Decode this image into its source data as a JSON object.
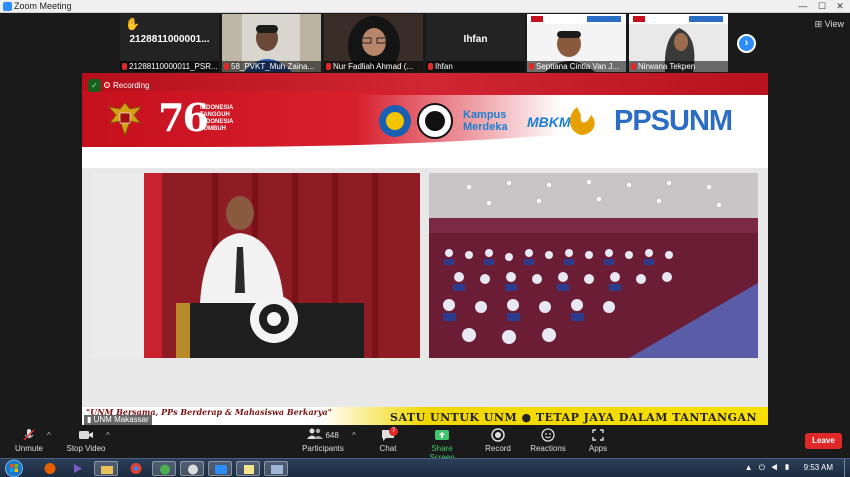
{
  "window": {
    "title": "Zoom Meeting",
    "minimize": "—",
    "maximize": "☐",
    "close": "✕"
  },
  "view_button": {
    "label": "View"
  },
  "gallery": {
    "tiles": [
      {
        "display": "2128811000001...",
        "name": "21288110000011_PSR...",
        "hand_raised": true
      },
      {
        "display": "",
        "name": "58_PVKT_Muh Zaina...",
        "hand_raised": false
      },
      {
        "display": "",
        "name": "Nur Fadliah Ahmad (...",
        "hand_raised": false
      },
      {
        "display": "Ihfan",
        "name": "Ihfan",
        "hand_raised": false
      },
      {
        "display": "",
        "name": "Septiana Cintia Van J...",
        "hand_raised": false
      },
      {
        "display": "",
        "name": "Nirwana Tekpen",
        "hand_raised": false
      }
    ]
  },
  "stage": {
    "recording_label": "Recording",
    "anniversary_number": "76",
    "slogan": [
      "INDONESIA",
      "TANGGUH",
      "INDONESIA",
      "TUMBUH"
    ],
    "logo_kampus": "Kampus",
    "logo_merdeka": "Merdeka",
    "logo_mbkm": "MBKM",
    "logo_pps": "PPS",
    "logo_unm": "UNM",
    "footer_tagline": "\"UNM Bersama, PPs Berderap & Mahasiswa Berkarya\"",
    "footer_ticker": "SATU UNTUK UNM  ●  TETAP JAYA DALAM TANTANGAN",
    "speaker_name_tag": "UNM Makassar"
  },
  "toolbar": {
    "unmute": "Unmute",
    "stop_video": "Stop Video",
    "participants": "Participants",
    "participants_count": "648",
    "chat": "Chat",
    "chat_badge": "7",
    "share_screen": "Share Screen",
    "record": "Record",
    "reactions": "Reactions",
    "apps": "Apps",
    "leave": "Leave",
    "caret": "^"
  },
  "taskbar": {
    "clock": "9:53 AM",
    "tray": "▲ ⏻ ◀ ▮"
  },
  "colors": {
    "zoom_blue": "#2d8cff",
    "leave_red": "#e02828",
    "share_green": "#3ec86b",
    "banner_red": "#c5101e"
  }
}
